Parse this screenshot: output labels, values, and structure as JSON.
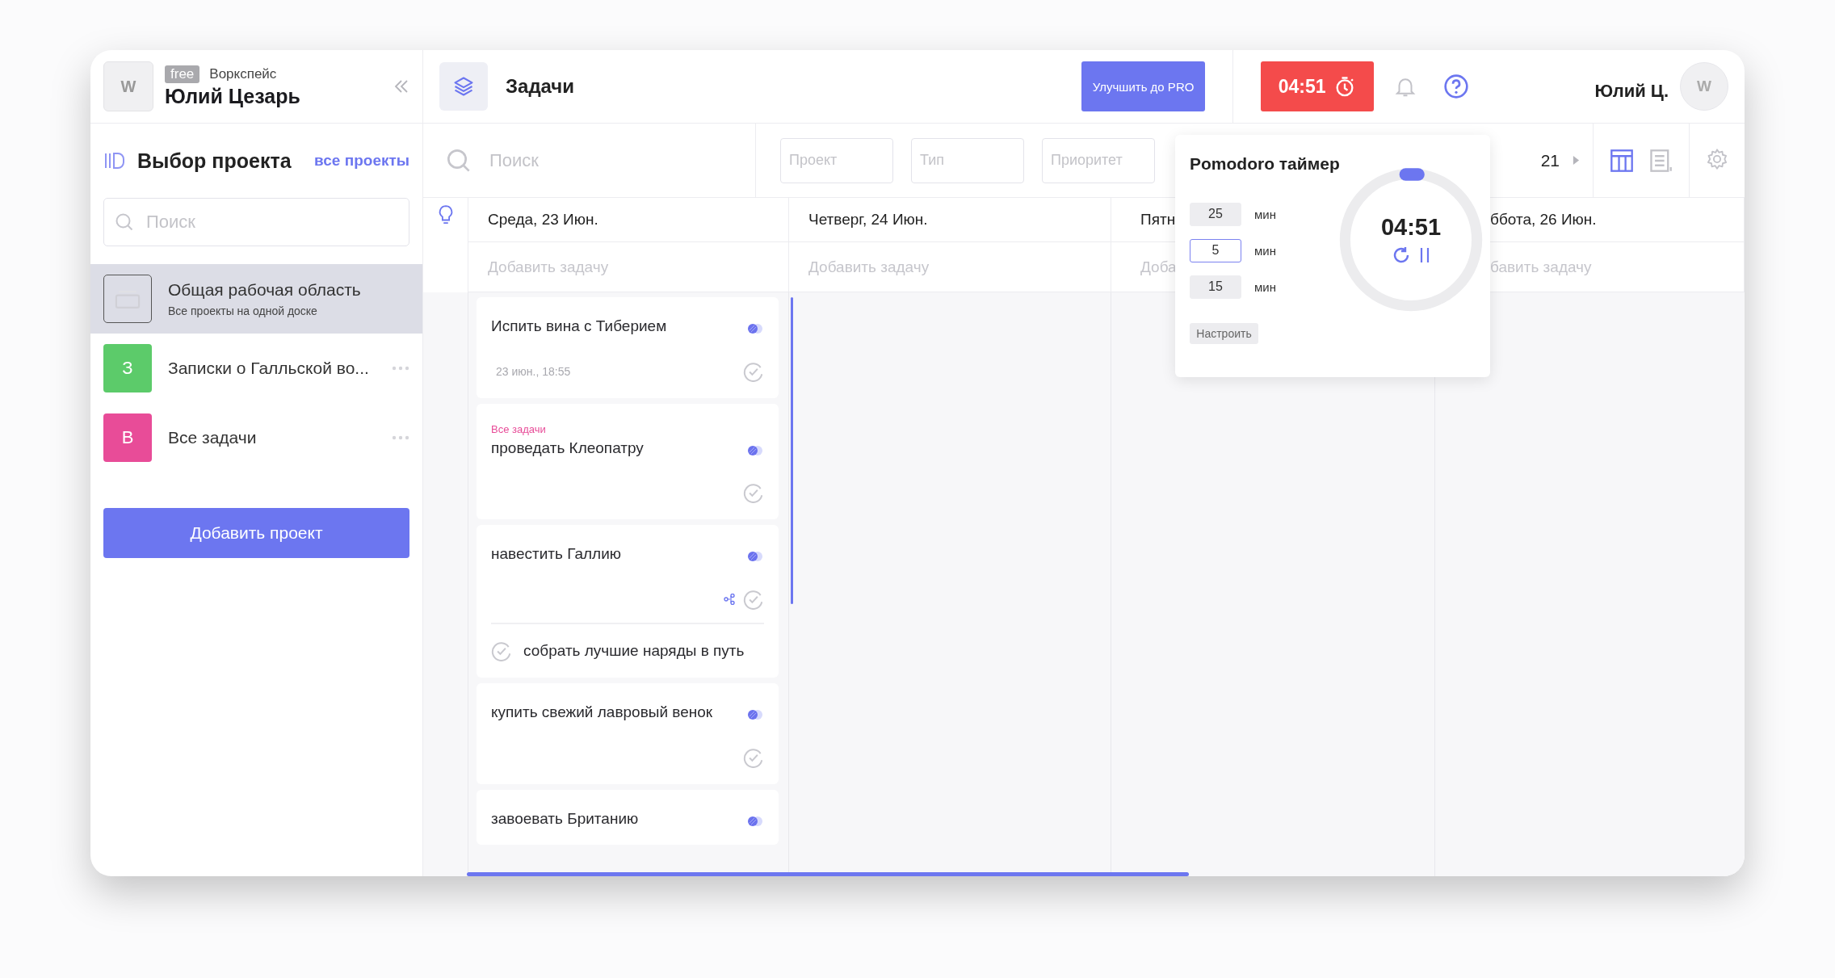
{
  "sidebar": {
    "workspace": {
      "avatar": "W",
      "plan": "free",
      "label": "Воркспейс",
      "name": "Юлий Цезарь"
    },
    "section_title": "Выбор проекта",
    "all_link": "все проекты",
    "search": {
      "placeholder": "Поиск"
    },
    "projects": [
      {
        "kind": "board",
        "name": "Общая рабочая область",
        "subtitle": "Все проекты на одной доске",
        "selected": true
      },
      {
        "kind": "letter",
        "letter": "З",
        "name": "Записки о Галльской во...",
        "color": "#5ccb6a",
        "selected": false
      },
      {
        "kind": "letter",
        "letter": "В",
        "name": "Все задачи",
        "color": "#e84c98",
        "selected": false
      }
    ],
    "add_button": "Добавить проект"
  },
  "topbar": {
    "title": "Задачи",
    "upgrade_button": "Улучшить до PRO",
    "timer": "04:51",
    "user_name": "Юлий Ц.",
    "avatar": "W"
  },
  "filters": {
    "search": {
      "placeholder": "Поиск"
    },
    "fields": [
      {
        "placeholder": "Проект"
      },
      {
        "placeholder": "Тип"
      },
      {
        "placeholder": "Приоритет"
      }
    ],
    "date_range": "21",
    "views": [
      {
        "kind": "board",
        "selected": true
      },
      {
        "kind": "list",
        "selected": false
      }
    ]
  },
  "days": [
    {
      "label": "Среда, 23 Июн.",
      "add_task": "Добавить задачу"
    },
    {
      "label": "Четверг, 24 Июн.",
      "add_task": "Добавить задачу"
    },
    {
      "label": "Пятн",
      "add_task": "Доба"
    },
    {
      "label": "ббота, 26 Июн.",
      "add_task": "бавить задачу"
    }
  ],
  "tasks": [
    {
      "title": "Испить вина с Тиберием",
      "date": "23 июн., 18:55"
    },
    {
      "title": "проведать Клеопатру",
      "project": "Все задачи",
      "color": "#e84c98"
    },
    {
      "title": "навестить Галлию",
      "subtasks": [
        {
          "title": "собрать лучшие наряды в путь"
        }
      ]
    },
    {
      "title": "купить свежий лавровый венок"
    },
    {
      "title": "завоевать Британию"
    }
  ],
  "pomodoro": {
    "title": "Pomodoro таймер",
    "durations": [
      {
        "value": "25",
        "unit": "мин",
        "selected": false
      },
      {
        "value": "5",
        "unit": "мин",
        "selected": true
      },
      {
        "value": "15",
        "unit": "мин",
        "selected": false
      }
    ],
    "settings_button": "Настроить",
    "time": "04:51"
  }
}
